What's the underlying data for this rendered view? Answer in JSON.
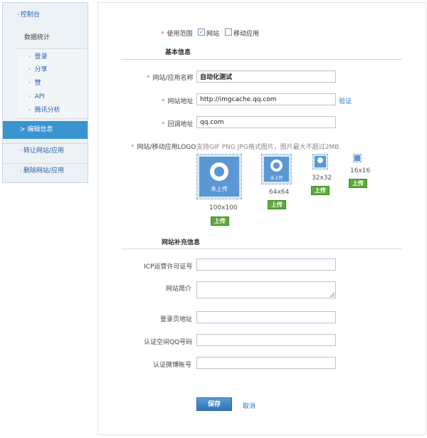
{
  "sidebar": {
    "top_item": "控制台",
    "stats_label": "数据统计",
    "sub_items": [
      "登录",
      "分享",
      "赞",
      "API",
      "腾讯分析"
    ],
    "active_item": "> 编辑信息",
    "item_transfer": "转让网站/应用",
    "item_delete": "删除网站/应用",
    "bullet": "·"
  },
  "form": {
    "scope_label": "使用范围",
    "scope_opt_site": "网站",
    "scope_opt_mobile": "移动应用",
    "basic_title": "基本信息",
    "name_label": "网站/应用名称",
    "name_value": "自动化测试",
    "url_label": "网站地址",
    "url_value": "http://imgcache.qq.com",
    "verify_link": "验证",
    "callback_label": "回调地址",
    "callback_value": "qq.com",
    "logo_label": "网站/移动应用LOGO",
    "logo_hint": "支持GIF PNG JPG格式图片，图片最大不超过2MB",
    "logo_not_uploaded": "未上传",
    "logo_sizes": [
      "100x100",
      "64x64",
      "32x32",
      "16x16"
    ],
    "upload_label": "上传",
    "extra_title": "网站补充信息",
    "icp_label": "ICP运营许可证号",
    "intro_label": "网站简介",
    "login_url_label": "登录页地址",
    "qq_label": "认证空间QQ号码",
    "weibo_label": "认证微博帐号",
    "save_label": "保存",
    "cancel_label": "取消",
    "required_mark": "*"
  },
  "colors": {
    "sidebar_active": "#3a94cf",
    "link": "#2a7ac4",
    "upload_green": "#5da93a",
    "required": "#e06b1e"
  }
}
